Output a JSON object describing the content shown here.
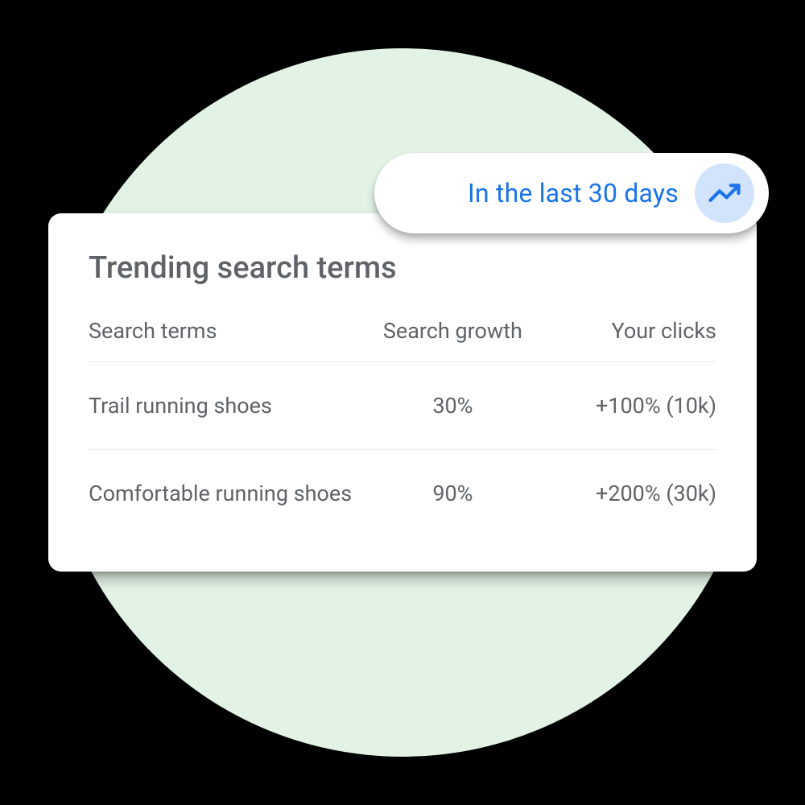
{
  "pill": {
    "label": "In the last 30 days"
  },
  "card": {
    "title": "Trending search terms",
    "columns": {
      "col1": "Search terms",
      "col2": "Search growth",
      "col3": "Your clicks"
    },
    "rows": [
      {
        "term": "Trail running shoes",
        "growth": "30%",
        "clicks": "+100% (10k)"
      },
      {
        "term": "Comfortable running shoes",
        "growth": "90%",
        "clicks": "+200% (30k)"
      }
    ]
  }
}
